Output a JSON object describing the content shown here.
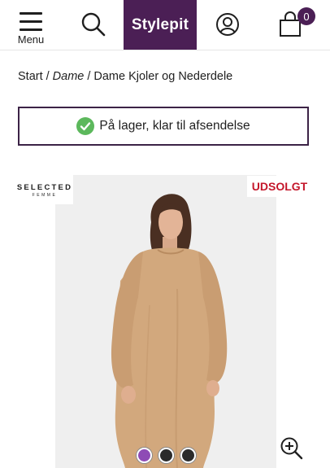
{
  "header": {
    "menu_label": "Menu",
    "logo_text": "Stylepit",
    "cart_count": "0",
    "brand_color": "#4b1f55"
  },
  "breadcrumb": {
    "items": [
      "Start",
      "Dame",
      "Dame Kjoler og Nederdele"
    ],
    "separator": "/"
  },
  "stock": {
    "text": "På lager, klar til afsendelse",
    "icon": "check-circle-icon",
    "icon_color": "#5cb85c"
  },
  "product": {
    "brand_top": "SELECTED",
    "brand_bottom": "FEMME",
    "badge": "UDSOLGT",
    "badge_color": "#c4162a",
    "zoom_icon": "zoom-in-icon",
    "swatch_colors": [
      "#8e4bb5",
      "#2b2b2b",
      "#2b2b2b"
    ]
  }
}
